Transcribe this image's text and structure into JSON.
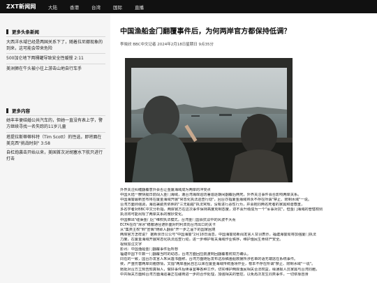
{
  "site": {
    "logo": "ZXT新闻网"
  },
  "nav": [
    "大陆",
    "香港",
    "台湾",
    "国际",
    "直播"
  ],
  "sidebar": {
    "section1": {
      "title": "更多头条新闻",
      "items": [
        "大西洋水域已经是两国关系下了，随着拉尼娜现象的到来，这可能会带来危险",
        "500加仑地下两桶罐导致安全性缓慢 2:11",
        "美洲狮在牛头被小往上游击山地自行车手"
      ]
    },
    "section2": {
      "title": "更多内容",
      "items": [
        "她丰丰便结婚公共汽车的，但她一直没有表上学，警方继续寻找一名失踪的11岁儿童",
        "塔提拉斯蒂蒂科特（Tim Scott）的性选，即将面在美克西\"挑战时刻\" 3:58",
        "自杠炮袭击开始以来，美国首次对胡塞水下航只进行打击"
      ]
    }
  },
  "article": {
    "title": "中国渔船金门翻覆事件后，为何两岸官方都保持低调？",
    "byline": "李晓欣 BBC中文记者 2024年2月18日星期日 9点35分",
    "paragraphs": [
      "外界关注纠缠翻覆意外会否让金厦海域成为两岸的冲突点",
      "中国大陆一艘快艇日前闯入金门海域，遭台湾海岸巡防署追逐期间翻覆后两死，外界关注事件会否影响两岸关系。",
      "中国海警最新宣布将在厦金海域开展\"常态化执法巡查行动\"，回台亦指厦金海域将永不存在所谓\"禁止、限制水域\"一说。",
      "台湾方面则强调，海巡署勤务依照的\"三无船舶\"执法常规，没有进行恶性行为，并会抱同两名死者的家属和谐尊重，",
      "多名学者对BBC中文分析指，两岸官方在这次事件保持高度克制态度，双不会升级成为一个\"军事对抗\"，但金门海域的管辖权则",
      "执法将可能出现了两岸关系的微妙变化。",
      "中国推出\"碰渠金门区\"维权执法模式，台湾金门国会抗议中的风波不大而",
      "ECFA在向\"滑冰\"稳撤通径遮折面对时利双向台湾出口的关卡",
      "从\"集类主权\"到\"宣偶\"随即入翻会\"开一步之遥下的国家困境",
      "两岸官方怎样说？ 据新京日公公号\"中国海警\"2月18日消息，中国海警局新闻发言人甘羽表示，福建海警局将加强厦门执法",
      "力度，在厦金海域开展常态化执法巡查行动，进一步维护有关海域作业秩序，维护渔民生命财产安全。",
      "视频加注文字",
      "影讯：中国渔船金门翻覆事件后所想",
      "福建中国下午数一门翻覆当时的动态，台湾方面回应航渡到回翻覆着附双方确认。",
      "同在的一致，国台办发言人朱凤莲书面称，台湾方面随后发布这原稿渔船救援所涉名单的语无端逃在系统事件。",
      "侯，严重伤害两岸同胞感情，又指\"两岸渔民自古以来在厦金海域传统渔场作业，根本不存在所谓\"禁止、限制水域\"一说\"。",
      "她批对台方立刻告知真相人，做好事件后续事宜等各种工作，切实维护两岸渔民相关合法权益，缘通报人员家属与台湾同胞，",
      "中共相关方面和台湾方面海巡署正在磋商进一步的合作处理，加强相关的管控，以免再次发生同类事件，一切依靠自身"
    ]
  }
}
